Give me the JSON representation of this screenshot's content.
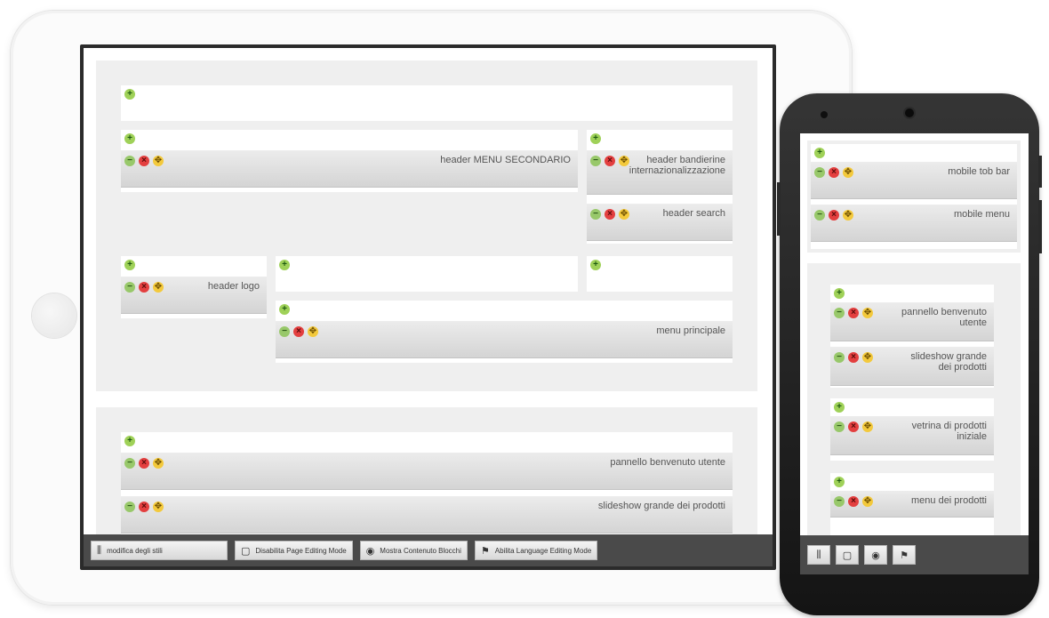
{
  "header_blocks": {
    "menu_secondario": "header MENU SECONDARIO",
    "bandierine": "header bandierine internazionalizzazione",
    "search": "header search",
    "logo": "header logo",
    "menu_principale": "menu principale"
  },
  "body_blocks": {
    "benvenuto": "pannello benvenuto utente",
    "slideshow": "slideshow grande dei prodotti"
  },
  "toolbar": {
    "styles": "modifica degli stili",
    "page_editing": "Disabilita Page Editing Mode",
    "show_contents": "Mostra Contenuto Blocchi",
    "language_editing": "Abilita Language Editing Mode"
  },
  "phone_blocks": {
    "top_bar": "mobile tob bar",
    "mobile_menu": "mobile menu",
    "benvenuto": "pannello benvenuto utente",
    "slideshow": "slideshow grande dei prodotti",
    "vetrina": "vetrina di prodotti iniziale",
    "menu_prodotti": "menu dei prodotti"
  },
  "colors": {
    "add": "#9fd158",
    "delete": "#e33f3f",
    "move": "#f3c93c",
    "toolbar": "#4a4a4a"
  },
  "icons": [
    "add-icon",
    "minimize-icon",
    "delete-icon",
    "move-icon",
    "sliders-icon",
    "square-icon",
    "eye-off-icon",
    "flag-icon"
  ]
}
